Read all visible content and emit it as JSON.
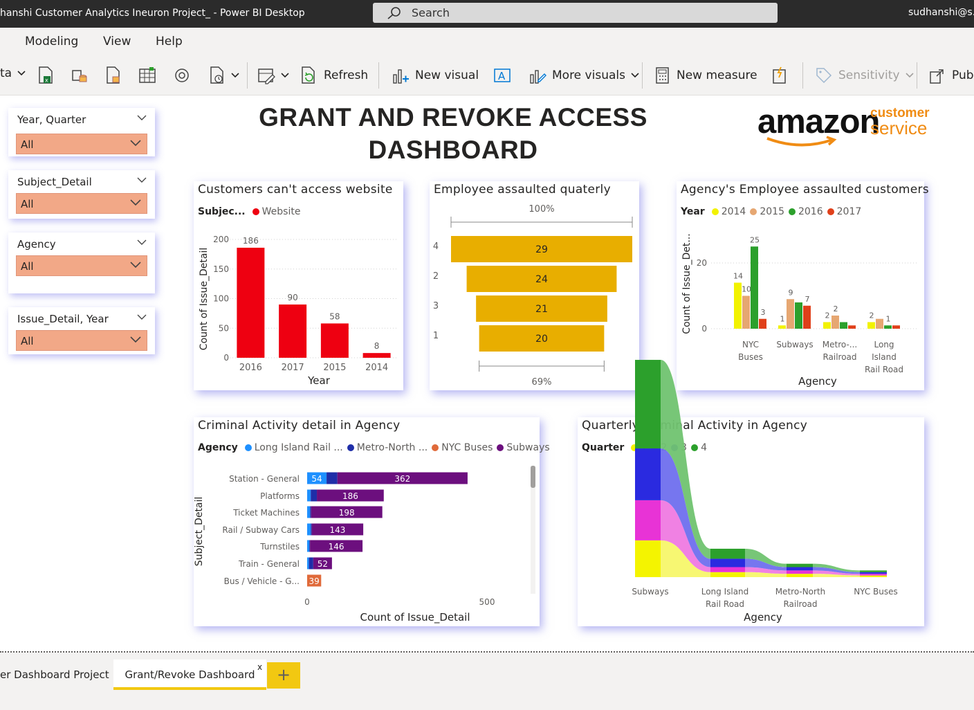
{
  "titlebar": {
    "app_title": "hanshi Customer Analytics Ineuron Project_ - Power BI Desktop",
    "search_placeholder": "Search",
    "user": "sudhanshi@s.a"
  },
  "menu": {
    "items": [
      "Modeling",
      "View",
      "Help"
    ]
  },
  "ribbon": {
    "data_partial": "ta",
    "refresh": "Refresh",
    "new_visual": "New visual",
    "more_visuals": "More visuals",
    "new_measure": "New measure",
    "sensitivity": "Sensitivity",
    "publish_partial": "Pub"
  },
  "slicers": [
    {
      "header": "Year, Quarter",
      "value": "All"
    },
    {
      "header": "Subject_Detail",
      "value": "All"
    },
    {
      "header": "Agency",
      "value": "All"
    },
    {
      "header": "Issue_Detail, Year",
      "value": "All"
    }
  ],
  "dashboard": {
    "title_line1": "GRANT AND REVOKE ACCESS",
    "title_line2": "DASHBOARD"
  },
  "logo": {
    "brand": "amazon",
    "sub1": "customer",
    "sub2": "service"
  },
  "visuals": {
    "website": {
      "title": "Customers can't access website",
      "legend_label": "Subjec...",
      "legend_item": "Website"
    },
    "funnel": {
      "title": "Employee assaulted quaterly"
    },
    "agency_emp": {
      "title": "Agency's Employee assaulted customers",
      "legend_label": "Year"
    },
    "criminal": {
      "title": "Criminal Activity detail in Agency",
      "legend_label": "Agency"
    },
    "quarterly": {
      "title": "Quarterly Criminal Activity in Agency",
      "legend_label": "Quarter"
    }
  },
  "colors": {
    "accent": "#f2c811",
    "slicer": "#f2a887",
    "red": "#ee0011",
    "funnel": "#e8ae00",
    "shadow": "#8f8ff0"
  },
  "chart_data": [
    {
      "id": "website",
      "type": "bar",
      "title": "Customers can't access website",
      "categories": [
        "2016",
        "2017",
        "2015",
        "2014"
      ],
      "series": [
        {
          "name": "Website",
          "values": [
            186,
            90,
            58,
            8
          ]
        }
      ],
      "xlabel": "Year",
      "ylabel": "Count of Issue_Detail",
      "ylim": [
        0,
        200
      ],
      "yticks": [
        "0",
        "50",
        "100",
        "150",
        "200"
      ],
      "grid": true
    },
    {
      "id": "funnel",
      "type": "bar",
      "title": "Employee assaulted quaterly",
      "categories": [
        "4",
        "2",
        "3",
        "1"
      ],
      "values": [
        29,
        24,
        21,
        20
      ],
      "top_label": "100%",
      "bottom_label": "69%"
    },
    {
      "id": "agency_emp",
      "type": "bar",
      "title": "Agency's Employee assaulted customers",
      "categories": [
        "NYC Buses",
        "Subways",
        "Metro-... Railroad",
        "Long Island Rail Road"
      ],
      "category_lines": [
        [
          "NYC",
          "Buses"
        ],
        [
          "Subways"
        ],
        [
          "Metro-...",
          "Railroad"
        ],
        [
          "Long",
          "Island",
          "Rail Road"
        ]
      ],
      "series": [
        {
          "name": "2014",
          "color": "#f2f200",
          "values": [
            14,
            1,
            2,
            2
          ]
        },
        {
          "name": "2015",
          "color": "#e6a772",
          "values": [
            10,
            9,
            4,
            3
          ]
        },
        {
          "name": "2016",
          "color": "#2ca02c",
          "values": [
            25,
            8,
            2,
            1
          ]
        },
        {
          "name": "2017",
          "color": "#e0401a",
          "values": [
            3,
            7,
            1,
            1
          ]
        }
      ],
      "data_labels": [
        [
          "14",
          "10",
          "25",
          "3"
        ],
        [
          "1",
          "9",
          "",
          "7"
        ],
        [
          "2",
          "2",
          "",
          ""
        ],
        [
          "2",
          "",
          "1",
          ""
        ]
      ],
      "xlabel": "Agency",
      "ylabel": "Count of Issue_Det...",
      "ylim": [
        0,
        28
      ],
      "yticks": [
        "0",
        "20"
      ],
      "grid": true
    },
    {
      "id": "criminal",
      "type": "bar",
      "title": "Criminal Activity detail in Agency",
      "categories": [
        "Station - General",
        "Platforms",
        "Ticket Machines",
        "Rail / Subway Cars",
        "Turnstiles",
        "Train - General",
        "Bus / Vehicle - G..."
      ],
      "series": [
        {
          "name": "Long Island Rail ...",
          "color": "#1e90ff",
          "values": [
            54,
            10,
            8,
            10,
            6,
            5,
            0
          ]
        },
        {
          "name": "Metro-North ...",
          "color": "#1f2ea8",
          "values": [
            30,
            17,
            3,
            3,
            2,
            12,
            0
          ]
        },
        {
          "name": "NYC Buses",
          "color": "#e06a3a",
          "values": [
            0,
            0,
            0,
            0,
            0,
            0,
            39
          ]
        },
        {
          "name": "Subways",
          "color": "#6c0f7e",
          "values": [
            362,
            186,
            198,
            143,
            146,
            52,
            0
          ]
        }
      ],
      "bar_labels": [
        "54",
        "362",
        "186",
        "198",
        "143",
        "146",
        "52",
        "39"
      ],
      "xlabel": "Count of Issue_Detail",
      "ylabel": "Subject_Detail",
      "xlim": [
        0,
        500
      ],
      "xticks": [
        "0",
        "500"
      ]
    },
    {
      "id": "quarterly",
      "type": "area",
      "title": "Quarterly Criminal Activity in Agency",
      "categories": [
        "Subways",
        "Long Island Rail Road",
        "Metro-North Railroad",
        "NYC Buses"
      ],
      "category_lines": [
        [
          "Subways"
        ],
        [
          "Long Island",
          "Rail Road"
        ],
        [
          "Metro-North",
          "Railroad"
        ],
        [
          "NYC Buses"
        ]
      ],
      "series": [
        {
          "name": "1",
          "color": "#f4f400",
          "values": [
            22,
            3,
            2,
            1
          ]
        },
        {
          "name": "2",
          "color": "#e833d6",
          "values": [
            24,
            3,
            2,
            1
          ]
        },
        {
          "name": "3",
          "color": "#2a2ae0",
          "values": [
            31,
            5,
            2,
            1
          ]
        },
        {
          "name": "4",
          "color": "#2ca02c",
          "values": [
            53,
            6,
            2,
            1
          ]
        }
      ],
      "xlabel": "Agency"
    }
  ],
  "tabs": {
    "tab1": "er Dashboard Project",
    "tab2": "Grant/Revoke Dashboard",
    "close": "x",
    "add": "+"
  }
}
